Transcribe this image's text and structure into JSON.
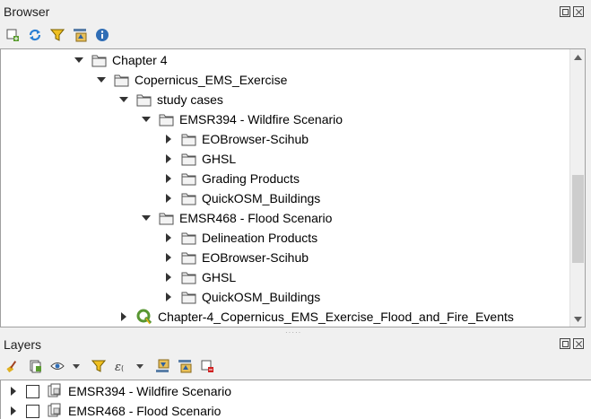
{
  "browser": {
    "title": "Browser",
    "toolbar": [
      {
        "name": "add-layer-icon"
      },
      {
        "name": "refresh-icon"
      },
      {
        "name": "filter-icon"
      },
      {
        "name": "collapse-all-icon"
      },
      {
        "name": "info-icon"
      }
    ],
    "tree": [
      {
        "label": "Chapter 4",
        "depth": 0,
        "expanded": true,
        "icon": "folder"
      },
      {
        "label": "Copernicus_EMS_Exercise",
        "depth": 1,
        "expanded": true,
        "icon": "folder"
      },
      {
        "label": "study cases",
        "depth": 2,
        "expanded": true,
        "icon": "folder"
      },
      {
        "label": "EMSR394 - Wildfire Scenario",
        "depth": 3,
        "expanded": true,
        "icon": "folder"
      },
      {
        "label": "EOBrowser-Scihub",
        "depth": 4,
        "expanded": false,
        "icon": "folder"
      },
      {
        "label": "GHSL",
        "depth": 4,
        "expanded": false,
        "icon": "folder"
      },
      {
        "label": "Grading Products",
        "depth": 4,
        "expanded": false,
        "icon": "folder"
      },
      {
        "label": "QuickOSM_Buildings",
        "depth": 4,
        "expanded": false,
        "icon": "folder"
      },
      {
        "label": "EMSR468 - Flood Scenario",
        "depth": 3,
        "expanded": true,
        "icon": "folder"
      },
      {
        "label": "Delineation Products",
        "depth": 4,
        "expanded": false,
        "icon": "folder"
      },
      {
        "label": "EOBrowser-Scihub",
        "depth": 4,
        "expanded": false,
        "icon": "folder"
      },
      {
        "label": "GHSL",
        "depth": 4,
        "expanded": false,
        "icon": "folder"
      },
      {
        "label": "QuickOSM_Buildings",
        "depth": 4,
        "expanded": false,
        "icon": "folder"
      },
      {
        "label": "Chapter-4_Copernicus_EMS_Exercise_Flood_and_Fire_Events",
        "depth": 2,
        "expanded": false,
        "icon": "qgis-project"
      }
    ]
  },
  "layers": {
    "title": "Layers",
    "toolbar": [
      {
        "name": "style-brush-icon"
      },
      {
        "name": "add-group-icon"
      },
      {
        "name": "visibility-eye-icon"
      },
      {
        "name": "filter-icon"
      },
      {
        "name": "filter-expression-icon"
      },
      {
        "name": "expand-all-icon"
      },
      {
        "name": "collapse-all-icon"
      },
      {
        "name": "remove-layer-icon"
      }
    ],
    "items": [
      {
        "label": "EMSR394 - Wildfire Scenario",
        "checked": false
      },
      {
        "label": "EMSR468 - Flood Scenario",
        "checked": false
      }
    ]
  },
  "colors": {
    "panel_bg": "#f0f0f0",
    "tree_bg": "#ffffff",
    "qgis_green": "#589632",
    "refresh_blue": "#2a7fd4"
  }
}
